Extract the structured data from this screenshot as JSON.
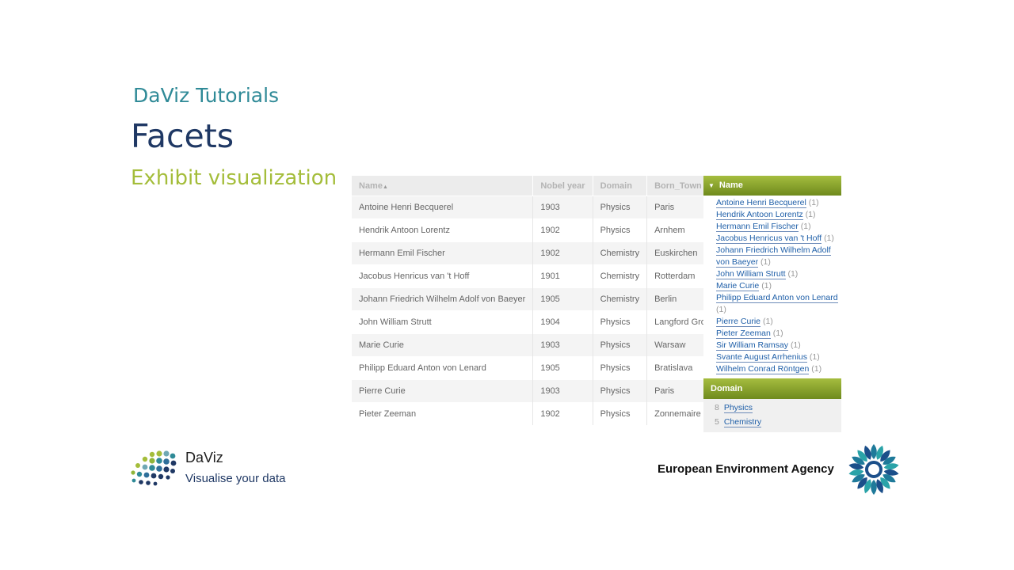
{
  "slide": {
    "subtitle": "DaViz Tutorials",
    "title": "Facets",
    "section": "Exhibit visualization"
  },
  "table": {
    "headers": [
      "Name",
      "Nobel year",
      "Domain",
      "Born_Town"
    ],
    "sort_indicator": "▲",
    "rows": [
      [
        "Antoine Henri Becquerel",
        "1903",
        "Physics",
        "Paris"
      ],
      [
        "Hendrik Antoon Lorentz",
        "1902",
        "Physics",
        "Arnhem"
      ],
      [
        "Hermann Emil Fischer",
        "1902",
        "Chemistry",
        "Euskirchen"
      ],
      [
        "Jacobus Henricus van 't Hoff",
        "1901",
        "Chemistry",
        "Rotterdam"
      ],
      [
        "Johann Friedrich Wilhelm Adolf von Baeyer",
        "1905",
        "Chemistry",
        "Berlin"
      ],
      [
        "John William Strutt",
        "1904",
        "Physics",
        "Langford Grove"
      ],
      [
        "Marie Curie",
        "1903",
        "Physics",
        "Warsaw"
      ],
      [
        "Philipp Eduard Anton von Lenard",
        "1905",
        "Physics",
        "Bratislava"
      ],
      [
        "Pierre Curie",
        "1903",
        "Physics",
        "Paris"
      ],
      [
        "Pieter Zeeman",
        "1902",
        "Physics",
        "Zonnemaire"
      ]
    ]
  },
  "facets": {
    "name": {
      "title": "Name",
      "items": [
        {
          "label": "Antoine Henri Becquerel",
          "count": "(1)"
        },
        {
          "label": "Hendrik Antoon Lorentz",
          "count": "(1)"
        },
        {
          "label": "Hermann Emil Fischer",
          "count": "(1)"
        },
        {
          "label": "Jacobus Henricus van 't Hoff",
          "count": "(1)"
        },
        {
          "label": "Johann Friedrich Wilhelm Adolf von Baeyer",
          "count": "(1)"
        },
        {
          "label": "John William Strutt",
          "count": "(1)"
        },
        {
          "label": "Marie Curie",
          "count": "(1)"
        },
        {
          "label": "Philipp Eduard Anton von Lenard",
          "count": "(1)"
        },
        {
          "label": "Pierre Curie",
          "count": "(1)"
        },
        {
          "label": "Pieter Zeeman",
          "count": "(1)"
        },
        {
          "label": "Sir William Ramsay",
          "count": "(1)"
        },
        {
          "label": "Svante August Arrhenius",
          "count": "(1)"
        },
        {
          "label": "Wilhelm Conrad Röntgen",
          "count": "(1)"
        }
      ]
    },
    "domain": {
      "title": "Domain",
      "items": [
        {
          "count": "8",
          "label": "Physics"
        },
        {
          "count": "5",
          "label": "Chemistry"
        }
      ]
    }
  },
  "footer": {
    "daviz_name": "DaViz",
    "daviz_tagline": "Visualise your data",
    "eea_name": "European Environment Agency"
  },
  "colors": {
    "accent_green": "#a4bd3a",
    "teal": "#2f8a97",
    "navy": "#1f3864",
    "link": "#1f5fa8"
  }
}
